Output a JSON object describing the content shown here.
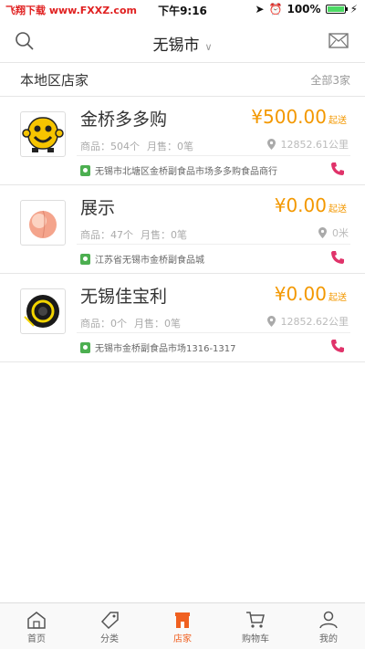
{
  "status": {
    "watermark": "飞翔下载 www.FXXZ.com",
    "time": "下午9:16",
    "battery": "100%"
  },
  "header": {
    "city": "无锡市",
    "chevron": "∨"
  },
  "section": {
    "title": "本地区店家",
    "count": "全部3家"
  },
  "stores": [
    {
      "name": "金桥多多购",
      "price": "¥500.00",
      "qisong": "起送",
      "goods": "商品：504个",
      "sales": "月售：0笔",
      "distance": "12852.61公里",
      "address": "无锡市北塘区金桥副食品市场多多购食品商行",
      "icon": "smiley-logo-icon"
    },
    {
      "name": "展示",
      "price": "¥0.00",
      "qisong": "起送",
      "goods": "商品：47个",
      "sales": "月售：0笔",
      "distance": "0米",
      "address": "江苏省无锡市金桥副食品城",
      "icon": "peach-icon"
    },
    {
      "name": "无锡佳宝利",
      "price": "¥0.00",
      "qisong": "起送",
      "goods": "商品：0个",
      "sales": "月售：0笔",
      "distance": "12852.62公里",
      "address": "无锡市金桥副食品市场1316-1317",
      "icon": "wheel-icon"
    }
  ],
  "tabbar": [
    {
      "label": "首页",
      "icon": "home-icon"
    },
    {
      "label": "分类",
      "icon": "tag-icon"
    },
    {
      "label": "店家",
      "icon": "store-icon",
      "active": true
    },
    {
      "label": "购物车",
      "icon": "cart-icon"
    },
    {
      "label": "我的",
      "icon": "user-icon"
    }
  ],
  "colors": {
    "accent": "#f39800",
    "active_tab": "#f06020",
    "address_pin": "#4caf50",
    "phone": "#e0336a"
  }
}
